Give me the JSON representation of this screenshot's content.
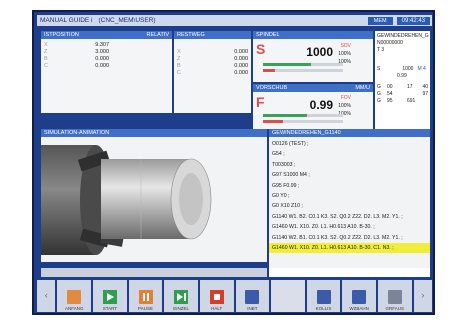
{
  "titlebar": {
    "mode": "MANUAL GUIDE i",
    "program": "(CNC_MEM\\USER)",
    "state": "MEM",
    "clock": "09:42:43"
  },
  "position": {
    "header": "ISTPOSITION",
    "header_right": "RELATIV",
    "rows": [
      {
        "axis": "X",
        "value": "9.307"
      },
      {
        "axis": "Z",
        "value": "3.000"
      },
      {
        "axis": "B",
        "value": "0.000"
      },
      {
        "axis": "C",
        "value": "0.000"
      }
    ]
  },
  "restweg": {
    "header": "RESTWEG",
    "rows": [
      {
        "axis": "X",
        "value": "0.000"
      },
      {
        "axis": "Z",
        "value": "0.000"
      },
      {
        "axis": "B",
        "value": "0.000"
      },
      {
        "axis": "C",
        "value": "0.000"
      }
    ]
  },
  "spindle": {
    "header": "SPINDEL",
    "letter": "S",
    "value": "1000",
    "unit": "SOV",
    "pct1": "100%",
    "pct2": "100%",
    "load1": 0.6,
    "load2": 0.15
  },
  "feed": {
    "header": "VORSCHUB",
    "header_right": "MM/U",
    "letter": "F",
    "value": "0.99",
    "unit": "FOV",
    "pct1": "100%",
    "pct2": "100%",
    "load1": 0.55,
    "load2": 0.25
  },
  "tool": {
    "line1": "GEWINDEDREHEN_G",
    "line2": "N00000000",
    "line3": "T 3",
    "s_label": "S",
    "s_value": "1000",
    "m_value": "M 4",
    "f_value": "0.99",
    "grid": [
      [
        "G",
        "00",
        "17",
        "40"
      ],
      [
        "G",
        "54",
        "",
        "97"
      ],
      [
        "G",
        "95",
        "691",
        ""
      ]
    ]
  },
  "simulation": {
    "header": "SIMULATION-ANIMATION"
  },
  "program": {
    "header": "GEWINDEDREHEN_G1140",
    "lines": [
      "O0126 (TEST) ;",
      "G54 ;",
      "T003003 ;",
      "G97 S1000 M4 ;",
      "G95 F0.99 ;",
      "G0 Y0 ;",
      "G0 X10 Z10 ;",
      "G1140 W1. B2. C0.1 K3. S2. Q0.2 Z22. D2. L3. M2. Y1. ;",
      "G1460 W1. X10. Z0. L1. H0.613 A10. B-30. ;",
      "G1140 W2. B1. C0.1 K3. S2. Q0.2 Z22. D2. L3. M2. Y1. ;"
    ],
    "highlight": "G1460 W1. X10. Z0. L1. H0.613 A10. B-30. C1. N3. ;"
  },
  "softkeys": {
    "anfang": "ANFANG",
    "start": "START",
    "pause": "PAUSE",
    "einzel": "EINZEL",
    "halt": "HALT",
    "inbt": "INBT",
    "kollis": "KOLLIS",
    "wzbahn": "WZBAHN",
    "grfaus": "GRFAUS"
  }
}
